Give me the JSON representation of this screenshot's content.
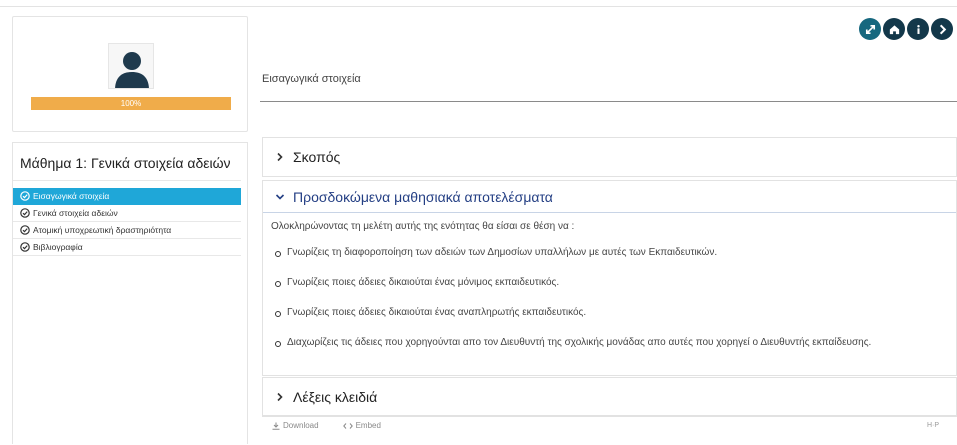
{
  "profile": {
    "avatar_icon": "user-silhouette-icon",
    "progress_percent": 100,
    "progress_label": "100%"
  },
  "lesson": {
    "title": "Μάθημα 1: Γενικά στοιχεία αδειών",
    "items": [
      {
        "label": "Εισαγωγικά στοιχεία",
        "active": true
      },
      {
        "label": "Γενικά στοιχεία αδειών",
        "active": false
      },
      {
        "label": "Ατομική υποχρεωτική δραστηριότητα",
        "active": false
      },
      {
        "label": "Βιβλιογραφία",
        "active": false
      }
    ]
  },
  "toolbar": {
    "icons": [
      "expand-icon",
      "home-icon",
      "info-icon",
      "next-icon"
    ]
  },
  "content": {
    "heading": "Εισαγωγικά στοιχεία",
    "sections": [
      {
        "title": "Σκοπός",
        "expanded": false
      },
      {
        "title": "Προσδοκώμενα μαθησιακά αποτελέσματα",
        "expanded": true
      },
      {
        "title": "Λέξεις κλειδιά",
        "expanded": false
      }
    ],
    "outcomes_intro": "Ολοκληρώνοντας τη μελέτη αυτής της ενότητας θα είσαι σε θέση να :",
    "outcomes": [
      "Γνωρίζεις τη διαφοροποίηση των αδειών των Δημοσίων υπαλλήλων με αυτές των Εκπαιδευτικών.",
      "Γνωρίζεις ποιες άδειες δικαιούται ένας μόνιμος εκπαιδευτικός.",
      "Γνωρίζεις ποιες άδειες δικαιούται ένας αναπληρωτής εκπαιδευτικός.",
      "Διαχωρίζεις τις άδειες που χορηγούνται απο τον Διευθυντή της σχολικής μονάδας απο αυτές που χορηγεί ο Διευθυντής εκπαίδευσης."
    ]
  },
  "footer": {
    "download_label": "Download",
    "embed_label": "Embed",
    "hp_label": "H·P"
  },
  "colors": {
    "accent": "#1fa7d8",
    "progress": "#f0ac4a",
    "toolbar_button": "#16687f",
    "open_section_title": "#243f84"
  }
}
